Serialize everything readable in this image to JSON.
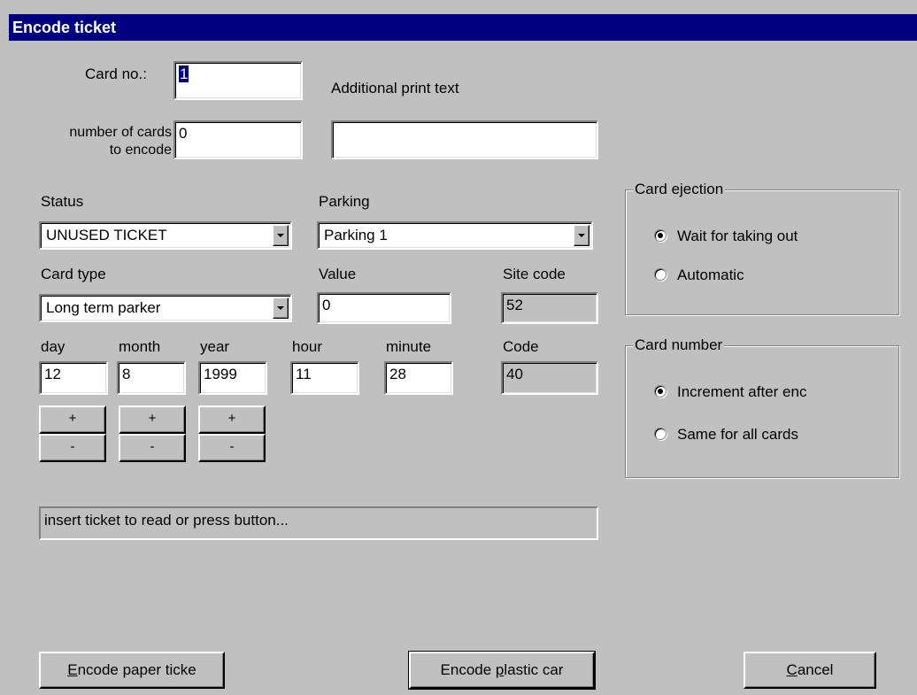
{
  "window": {
    "title": "Encode ticket"
  },
  "card_no": {
    "label": "Card no.:",
    "value": "1"
  },
  "num_cards": {
    "label_line1": "number of cards",
    "label_line2": "to encode",
    "value": "0"
  },
  "print_text": {
    "label": "Additional print text",
    "value": ""
  },
  "status": {
    "label": "Status",
    "value": "UNUSED TICKET"
  },
  "parking": {
    "label": "Parking",
    "value": "Parking 1"
  },
  "card_type": {
    "label": "Card type",
    "value": "Long term parker"
  },
  "value_field": {
    "label": "Value",
    "value": "0"
  },
  "site_code": {
    "label": "Site code",
    "value": "52"
  },
  "date": {
    "day": {
      "label": "day",
      "value": "12"
    },
    "month": {
      "label": "month",
      "value": "8"
    },
    "year": {
      "label": "year",
      "value": "1999"
    },
    "hour": {
      "label": "hour",
      "value": "11"
    },
    "minute": {
      "label": "minute",
      "value": "28"
    }
  },
  "code": {
    "label": "Code",
    "value": "40"
  },
  "stepper": {
    "plus": "+",
    "minus": "-"
  },
  "status_line": "insert ticket to read or press button...",
  "card_ejection": {
    "title": "Card ejection",
    "options": [
      {
        "label": "Wait for taking out",
        "selected": true
      },
      {
        "label": "Automatic",
        "selected": false
      }
    ]
  },
  "card_number": {
    "title": "Card number",
    "options": [
      {
        "label": "Increment after enc",
        "selected": true
      },
      {
        "label": "Same for all cards",
        "selected": false
      }
    ]
  },
  "buttons": {
    "encode_paper": {
      "hotkey": "E",
      "rest": "ncode paper ticke"
    },
    "encode_plastic_pre": "Encode ",
    "encode_plastic_hotkey": "p",
    "encode_plastic_post": "lastic car",
    "cancel": {
      "hotkey": "C",
      "rest": "ancel"
    }
  },
  "colors": {
    "face": "#c0c0c0",
    "title_bar": "#000080",
    "selection": "#000080"
  }
}
